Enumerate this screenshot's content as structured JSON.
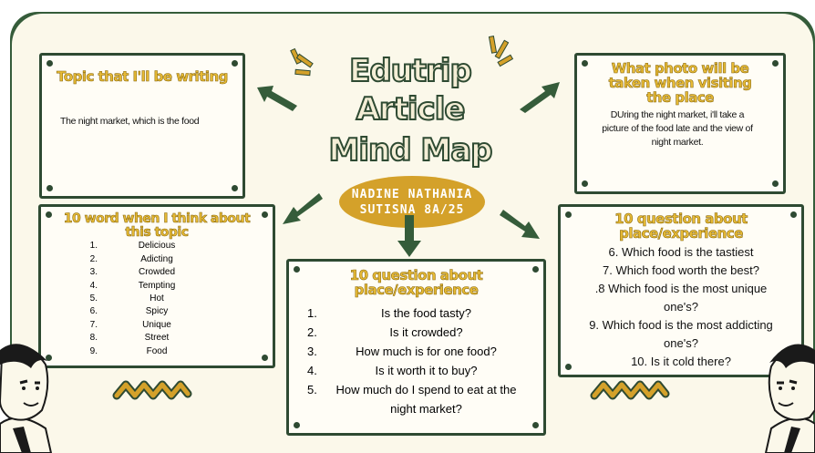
{
  "title": {
    "line1": "Edutrip",
    "line2": "Article",
    "line3": "Mind Map"
  },
  "author": {
    "line1": "NADINE NATHANIA",
    "line2": "SUTISNA 8A/25"
  },
  "topic_card": {
    "title": "Topic that I'll be writing",
    "body": "The night market, which is the food"
  },
  "photo_card": {
    "title_line1": "What photo will be",
    "title_line2": "taken when visiting",
    "title_line3": "the place",
    "body": "DUring the night market, i'll take a picture of the food late and the view of night market."
  },
  "words_card": {
    "title_line1": "10 word when I think about",
    "title_line2": "this topic",
    "items": [
      {
        "num": "1.",
        "word": "Delicious"
      },
      {
        "num": "2.",
        "word": "Adicting"
      },
      {
        "num": "3.",
        "word": "Crowded"
      },
      {
        "num": "4.",
        "word": "Tempting"
      },
      {
        "num": "5.",
        "word": "Hot"
      },
      {
        "num": "6.",
        "word": "Spicy"
      },
      {
        "num": "7.",
        "word": "Unique"
      },
      {
        "num": "8.",
        "word": "Street"
      },
      {
        "num": "9.",
        "word": "Food"
      }
    ]
  },
  "questions_center": {
    "title_line1": "10 question about",
    "title_line2": "place/experience",
    "items": [
      {
        "num": "1.",
        "text": "Is the food tasty?"
      },
      {
        "num": "2.",
        "text": "Is it crowded?"
      },
      {
        "num": "3.",
        "text": "How much is for one food?"
      },
      {
        "num": "4.",
        "text": "Is it worth it to buy?"
      },
      {
        "num": "5.",
        "text": "How much do I spend to eat at the night market?"
      }
    ]
  },
  "questions_right": {
    "title_line1": "10 question about",
    "title_line2": "place/experience",
    "lines": [
      "6. Which food is the tastiest",
      "7. Which food worth the best?",
      ".8 Which food is the most unique one's?",
      "9.  Which food is the most addicting one's?",
      "10. Is it cold there?"
    ]
  },
  "colors": {
    "board": "#355c3a",
    "paper": "#fbf8ea",
    "accent": "#d4a12a",
    "ink": "#2e4a32"
  },
  "icons": [
    "arrow-icon",
    "sparkle-icon",
    "squiggle-icon",
    "character-illustration"
  ]
}
